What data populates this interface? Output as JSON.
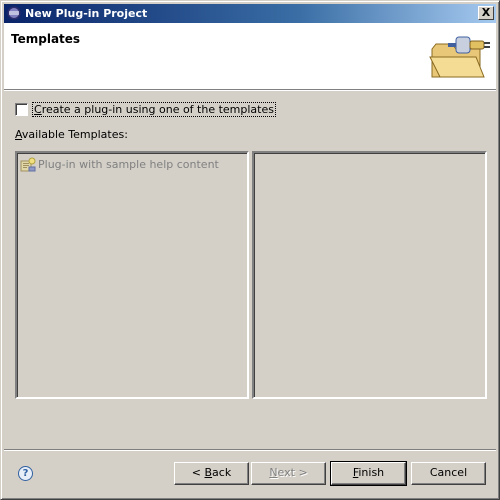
{
  "window": {
    "title": "New Plug-in Project",
    "close_glyph": "X",
    "icon": "eclipse-icon"
  },
  "banner": {
    "title": "Templates",
    "graphic": "plugin-folder-icon"
  },
  "options": {
    "use_template_checkbox": {
      "mnemonic": "C",
      "label_rest": "reate a plug-in using one of the templates",
      "checked": false
    },
    "available_templates_label": {
      "mnemonic": "A",
      "label_rest": "vailable Templates:"
    }
  },
  "templates": {
    "items": [
      {
        "label": "Plug-in with sample help content",
        "icon": "plugin-template-icon",
        "enabled": false
      }
    ],
    "description": ""
  },
  "footer": {
    "help_glyph": "?",
    "back": {
      "prefix": "< ",
      "mnemonic": "B",
      "rest": "ack"
    },
    "next": {
      "mnemonic": "N",
      "rest": "ext >",
      "enabled": false
    },
    "finish": {
      "mnemonic": "F",
      "rest": "inish"
    },
    "cancel": {
      "label": "Cancel"
    }
  },
  "colors": {
    "titlebar_start": "#0a246a",
    "titlebar_end": "#a6caf0",
    "dialog_bg": "#d4d0c8",
    "disabled_text": "#808080"
  }
}
